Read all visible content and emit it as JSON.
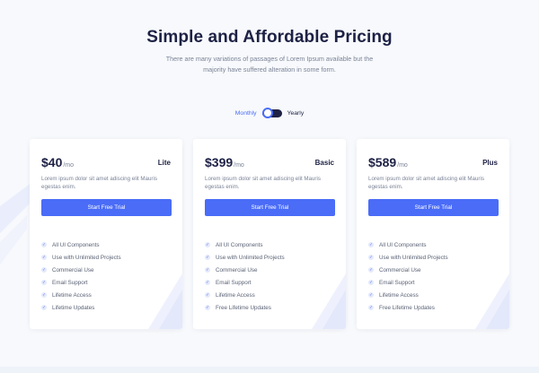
{
  "header": {
    "title": "Simple and Affordable Pricing",
    "subtitle_line1": "There are many variations of passages of Lorem Ipsum available but the",
    "subtitle_line2": "majority have suffered alteration in some form."
  },
  "billing_toggle": {
    "monthly_label": "Monthly",
    "yearly_label": "Yearly"
  },
  "colors": {
    "accent": "#4a6cf7",
    "heading": "#1d2144",
    "body_text": "#7b8397",
    "background": "#f7f9fc"
  },
  "plans": [
    {
      "price": "$40",
      "period": "/mo",
      "name": "Lite",
      "description": "Lorem ipsum dolor sit amet adiscing elit Mauris egestas enim.",
      "cta": "Start Free Trial",
      "features": [
        "All UI Components",
        "Use with Unlimited Projects",
        "Commercial Use",
        "Email Support",
        "Lifetime Access",
        "Lifetime Updates"
      ],
      "feature_icon": "check-icon"
    },
    {
      "price": "$399",
      "period": "/mo",
      "name": "Basic",
      "description": "Lorem ipsum dolor sit amet adiscing elit Mauris egestas enim.",
      "cta": "Start Free Trial",
      "features": [
        "All UI Components",
        "Use with Unlimited Projects",
        "Commercial Use",
        "Email Support",
        "Lifetime Access",
        "Free Lifetime Updates"
      ],
      "feature_icon": "check-icon"
    },
    {
      "price": "$589",
      "period": "/mo",
      "name": "Plus",
      "description": "Lorem ipsum dolor sit amet adiscing elit Mauris egestas enim.",
      "cta": "Start Free Trial",
      "features": [
        "All UI Components",
        "Use with Unlimited Projects",
        "Commercial Use",
        "Email Support",
        "Lifetime Access",
        "Free Lifetime Updates"
      ],
      "feature_icon": "check-icon"
    }
  ]
}
